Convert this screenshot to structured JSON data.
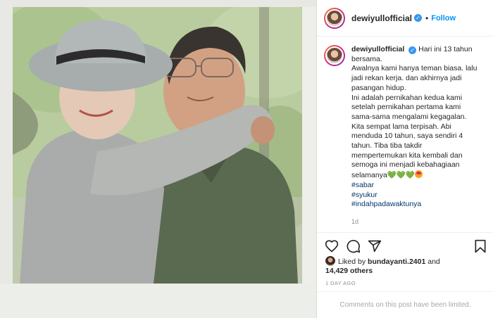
{
  "post": {
    "username": "dewiyullofficial",
    "verified_mark": "✓",
    "separator": "•",
    "follow_label": "Follow",
    "caption_lines": [
      "Hari ini 13 tahun",
      "bersama.",
      "Awalnya kami hanya teman biasa. lalu",
      "jadi rekan kerja. dan akhirnya jadi",
      "pasangan hidup.",
      "Ini adalah pernikahan kedua kami",
      "setelah pernikahan pertama kami",
      "sama-sama mengalami kegagalan.",
      "Kita sempat lama terpisah. Abi",
      "menduda 10 tahun, saya sendiri 4",
      "tahun. Tiba tiba takdir",
      "mempertemukan kita kembali dan",
      "semoga ini menjadi kebahagiaan",
      "selamanya"
    ],
    "caption_emoji": "💚💚💚",
    "hashtags": [
      "#sabar",
      "#syukur",
      "#indahpadawaktunya"
    ],
    "caption_time": "1d",
    "liked_by_prefix": "Liked by",
    "liked_by_user": "bundayanti.2401",
    "liked_by_and": "and",
    "likes_count": "14,429 others",
    "posted_ago": "1 DAY AGO",
    "comments_limited": "Comments on this post have been limited."
  },
  "icons": {
    "like": "heart-icon",
    "comment": "comment-icon",
    "share": "share-icon",
    "save": "bookmark-icon"
  },
  "colors": {
    "link_blue": "#0095f6",
    "hashtag": "#00376b",
    "text": "#262626",
    "muted": "#8e8e8e"
  }
}
